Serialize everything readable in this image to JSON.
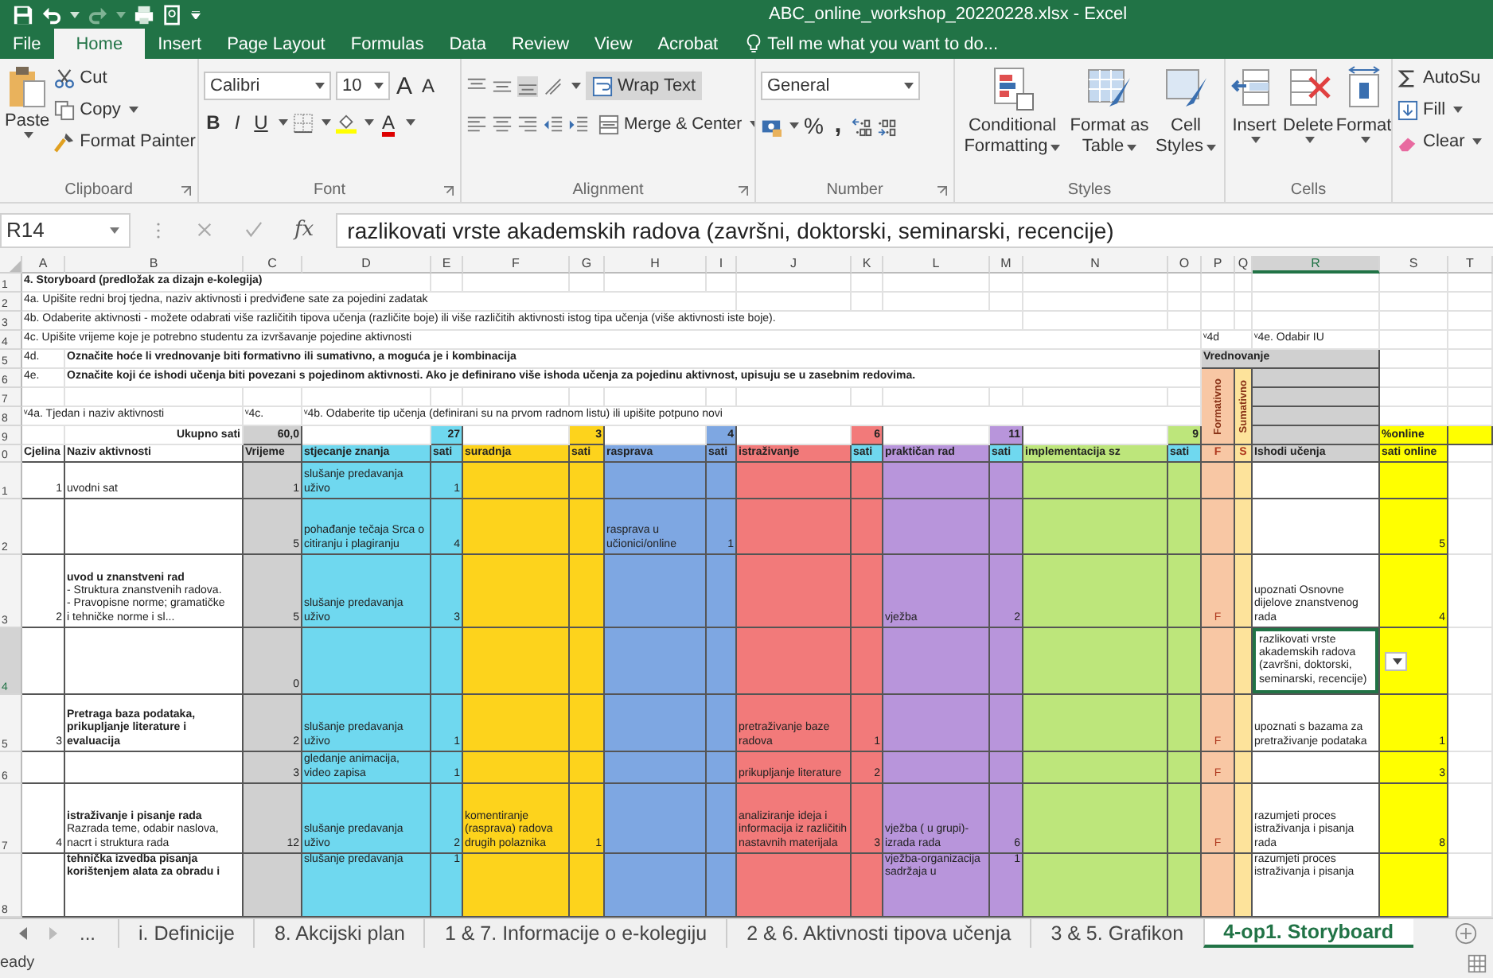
{
  "title_bar": {
    "title": "ABC_online_workshop_20220228.xlsx - Excel"
  },
  "ribbon_tabs": [
    {
      "label": "File",
      "selected": false
    },
    {
      "label": "Home",
      "selected": true
    },
    {
      "label": "Insert",
      "selected": false
    },
    {
      "label": "Page Layout",
      "selected": false
    },
    {
      "label": "Formulas",
      "selected": false
    },
    {
      "label": "Data",
      "selected": false
    },
    {
      "label": "Review",
      "selected": false
    },
    {
      "label": "View",
      "selected": false
    },
    {
      "label": "Acrobat",
      "selected": false
    }
  ],
  "tell_me": {
    "placeholder": "Tell me what you want to do..."
  },
  "clipboard": {
    "paste": "Paste",
    "cut": "Cut",
    "copy": "Copy",
    "format_painter": "Format Painter",
    "label": "Clipboard"
  },
  "font": {
    "family": "Calibri",
    "size": "10",
    "grow": "A",
    "shrink": "A",
    "bold": "B",
    "italic": "I",
    "underline": "U",
    "font_color": "A",
    "label": "Font"
  },
  "alignment": {
    "wrap_text": "Wrap Text",
    "merge": "Merge & Center",
    "label": "Alignment"
  },
  "number": {
    "format": "General",
    "percent": "%",
    "comma": ",",
    "label": "Number"
  },
  "styles": {
    "label": "Styles",
    "buttons": [
      {
        "label": "Conditional Formatting",
        "kind": "conditional"
      },
      {
        "label": "Format as Table",
        "kind": "table"
      },
      {
        "label": "Cell Styles",
        "kind": "cellstyle"
      }
    ]
  },
  "cells": {
    "label": "Cells",
    "buttons": [
      {
        "label": "Insert",
        "kind": "insert"
      },
      {
        "label": "Delete",
        "kind": "delete"
      },
      {
        "label": "Format",
        "kind": "format"
      }
    ]
  },
  "editing": {
    "autosum": "AutoSu",
    "fill": "Fill",
    "clear": "Clear"
  },
  "formula_bar": {
    "name_box": "R14",
    "fx": "fx",
    "formula": "razlikovati vrste akademskih radova (završni, doktorski, seminarski, recencije)"
  },
  "sheet": {
    "columns": [
      {
        "label": "A",
        "selected": false
      },
      {
        "label": "B",
        "selected": false
      },
      {
        "label": "C",
        "selected": false
      },
      {
        "label": "D",
        "selected": false
      },
      {
        "label": "E",
        "selected": false
      },
      {
        "label": "F",
        "selected": false
      },
      {
        "label": "G",
        "selected": false
      },
      {
        "label": "H",
        "selected": false
      },
      {
        "label": "I",
        "selected": false
      },
      {
        "label": "J",
        "selected": false
      },
      {
        "label": "K",
        "selected": false
      },
      {
        "label": "L",
        "selected": false
      },
      {
        "label": "M",
        "selected": false
      },
      {
        "label": "N",
        "selected": false
      },
      {
        "label": "O",
        "selected": false
      },
      {
        "label": "P",
        "selected": false
      },
      {
        "label": "Q",
        "selected": false
      },
      {
        "label": "R",
        "selected": true
      },
      {
        "label": "S",
        "selected": false
      },
      {
        "label": "T",
        "selected": false
      }
    ],
    "rows": [
      {
        "number": "1",
        "kind": "note",
        "selected": false,
        "cells": [
          {
            "text": "4. Storyboard (predložak za dizajn e-kolegija)",
            "kind": "bold"
          },
          {},
          {},
          {}
        ]
      },
      {
        "number": "2",
        "kind": "note",
        "selected": false,
        "cells": [
          {
            "text": "4a. Upišite redni broj tjedna, naziv aktivnosti i predviđene sate za pojedini zadatak",
            "kind": "text"
          },
          {},
          {},
          {},
          {},
          {},
          {},
          {},
          {}
        ]
      },
      {
        "number": "3",
        "kind": "note",
        "selected": false,
        "cells": [
          {
            "text": "4b. Odaberite aktivnosti - možete odabrati više različitih tipova učenja (različite boje) ili više različitih aktivnosti istog tipa učenja (više aktivnosti iste boje).",
            "kind": "text"
          },
          {},
          {},
          {},
          {},
          {},
          {},
          {},
          {},
          {},
          {},
          {},
          {}
        ]
      },
      {
        "number": "4",
        "kind": "note",
        "selected": false,
        "cells": [
          {
            "text": "4c. Upišite  vrijeme koje je potrebno studentu za izvršavanje pojedine aktivnosti",
            "kind": "text"
          },
          {},
          {},
          {},
          {},
          {},
          {},
          {},
          {},
          {},
          {},
          {},
          {},
          {},
          {},
          {
            "text": "ᵛ4d",
            "kind": "text"
          },
          {},
          {
            "text": "ᵛ4e. Odabir IU",
            "kind": "text"
          }
        ]
      },
      {
        "number": "5",
        "kind": "note",
        "selected": false,
        "cells": [
          {
            "text": "4d.",
            "kind": "text"
          },
          {
            "text": "Označite hoće li vrednovanje biti formativno ili sumativno, a moguća je i kombinacija",
            "kind": "bold"
          },
          {},
          {},
          {},
          {},
          {},
          {},
          {},
          {},
          {},
          {},
          {},
          {},
          {},
          {
            "text": "Vrednovanje",
            "kind": "bold",
            "color": "#d0d0d0"
          },
          {},
          {}
        ]
      },
      {
        "number": "6",
        "kind": "note",
        "selected": false,
        "cells": [
          {
            "text": "4e.",
            "kind": "text"
          },
          {
            "text": "Označite koji će ishodi učenja biti povezani s pojedinom aktivnosti. Ako je definirano više ishoda učenja za pojedinu aktivnost, upisuju se u zasebnim redovima.",
            "kind": "bold"
          },
          {},
          {},
          {},
          {},
          {},
          {},
          {},
          {},
          {},
          {},
          {},
          {},
          {},
          {
            "text": "Formativno",
            "kind": "vertical",
            "color": "#f8c7a4"
          },
          {
            "text": "Sumativno",
            "kind": "vertical",
            "color": "#fde39b"
          },
          {
            "color": "#d0d0d0"
          }
        ]
      },
      {
        "number": "7",
        "kind": "note",
        "selected": false,
        "cells": [
          {},
          {},
          {},
          {},
          {},
          {},
          {},
          {},
          {},
          {},
          {},
          {},
          {},
          {},
          {},
          {},
          {},
          {
            "color": "#d0d0d0"
          }
        ]
      },
      {
        "number": "8",
        "kind": "note",
        "selected": false,
        "cells": [
          {
            "text": "ᵛ4a. Tjedan i naziv aktivnosti",
            "kind": "text"
          },
          {},
          {
            "text": "ᵛ4c.",
            "kind": "text"
          },
          {
            "text": "ᵛ4b. Odaberite tip učenja (definirani su na prvom radnom listu) ili upišite potpuno novi",
            "kind": "text"
          },
          {},
          {},
          {},
          {},
          {},
          {},
          {},
          {},
          {},
          {},
          {},
          {},
          {},
          {
            "color": "#d0d0d0"
          }
        ]
      },
      {
        "number": "9",
        "kind": "total",
        "selected": false,
        "cells": [
          {},
          {
            "text": "Ukupno sati",
            "kind": "number"
          },
          {
            "text": "60,0",
            "kind": "number",
            "color": "#d0d0d0"
          },
          {},
          {
            "text": "27",
            "kind": "number",
            "color": "#6fd8ef"
          },
          {},
          {
            "text": "3",
            "kind": "number",
            "color": "#fdd31c"
          },
          {},
          {
            "text": "4",
            "kind": "number",
            "color": "#7ea7e2"
          },
          {},
          {
            "text": "6",
            "kind": "number",
            "color": "#f27a7a"
          },
          {},
          {
            "text": "11",
            "kind": "number",
            "color": "#b895db"
          },
          {},
          {
            "text": "9",
            "kind": "number",
            "color": "#bde67b"
          },
          {},
          {},
          {
            "color": "#d0d0d0"
          },
          {
            "text": "%online",
            "kind": "text",
            "color": "#ffff00"
          },
          {
            "color": "#ffff00"
          }
        ]
      },
      {
        "number": "0",
        "kind": "header",
        "selected": false,
        "cells": [
          {
            "text": "Cjelina",
            "kind": "text"
          },
          {
            "text": "Naziv aktivnosti",
            "kind": "text"
          },
          {
            "text": "Vrijeme",
            "kind": "text",
            "color": "#d0d0d0"
          },
          {
            "text": "stjecanje znanja",
            "kind": "text",
            "color": "#6fd8ef"
          },
          {
            "text": "sati",
            "kind": "text",
            "color": "#6fd8ef"
          },
          {
            "text": "suradnja",
            "kind": "text",
            "color": "#fdd31c"
          },
          {
            "text": "sati",
            "kind": "text",
            "color": "#fdd31c"
          },
          {
            "text": "rasprava",
            "kind": "text",
            "color": "#7ea7e2"
          },
          {
            "text": "sati",
            "kind": "text",
            "color": "#7ea7e2"
          },
          {
            "text": "istraživanje",
            "kind": "text",
            "color": "#f27a7a"
          },
          {
            "text": "sati",
            "kind": "text",
            "color": "#6fd8ef"
          },
          {
            "text": "praktičan rad",
            "kind": "text",
            "color": "#b895db"
          },
          {
            "text": "sati",
            "kind": "text",
            "color": "#6fd8ef"
          },
          {
            "text": "implementacija sz",
            "kind": "text",
            "color": "#bde67b"
          },
          {
            "text": "sati",
            "kind": "text",
            "color": "#6fd8ef"
          },
          {
            "text": "F",
            "kind": "center",
            "color": "#f8c7a4"
          },
          {
            "text": "S",
            "kind": "center",
            "color": "#fde39b"
          },
          {
            "text": "Ishodi učenja",
            "kind": "text",
            "color": "#d0d0d0"
          },
          {
            "text": "sati online",
            "kind": "text",
            "color": "#ffff00"
          },
          {}
        ]
      },
      {
        "number": "1",
        "kind": "data",
        "selected": false,
        "cells": [
          {
            "text": "1",
            "kind": "number"
          },
          {
            "text": "uvodni sat",
            "kind": "text"
          },
          {
            "text": "1",
            "kind": "number",
            "color": "#d0d0d0"
          },
          {
            "text": "slušanje predavanja uživo",
            "kind": "text",
            "color": "#6fd8ef"
          },
          {
            "text": "1",
            "kind": "number",
            "color": "#6fd8ef"
          },
          {
            "color": "#fdd31c"
          },
          {
            "color": "#fdd31c"
          },
          {
            "color": "#7ea7e2"
          },
          {
            "color": "#7ea7e2"
          },
          {
            "color": "#f27a7a"
          },
          {
            "color": "#f27a7a"
          },
          {
            "color": "#b895db"
          },
          {
            "color": "#b895db"
          },
          {
            "color": "#bde67b"
          },
          {
            "color": "#bde67b"
          },
          {
            "color": "#f8c7a4"
          },
          {
            "color": "#fde39b"
          },
          {},
          {
            "color": "#ffff00"
          },
          {}
        ]
      },
      {
        "number": "2",
        "kind": "data",
        "selected": false,
        "cells": [
          {},
          {},
          {
            "text": "5",
            "kind": "number",
            "color": "#d0d0d0"
          },
          {
            "text": "pohađanje tečaja Srca o citiranju i plagiranju",
            "kind": "text",
            "color": "#6fd8ef"
          },
          {
            "text": "4",
            "kind": "number",
            "color": "#6fd8ef"
          },
          {
            "color": "#fdd31c"
          },
          {
            "color": "#fdd31c"
          },
          {
            "text": "rasprava u učionici/online",
            "kind": "text",
            "color": "#7ea7e2"
          },
          {
            "text": "1",
            "kind": "number",
            "color": "#7ea7e2"
          },
          {
            "color": "#f27a7a"
          },
          {
            "color": "#f27a7a"
          },
          {
            "color": "#b895db"
          },
          {
            "color": "#b895db"
          },
          {
            "color": "#bde67b"
          },
          {
            "color": "#bde67b"
          },
          {
            "color": "#f8c7a4"
          },
          {
            "color": "#fde39b"
          },
          {},
          {
            "text": "5",
            "kind": "number",
            "color": "#ffff00"
          },
          {}
        ]
      },
      {
        "number": "3",
        "kind": "data",
        "selected": false,
        "cells": [
          {
            "text": "2",
            "kind": "number"
          },
          {
            "text": "**uvod u znanstveni rad**\n- Struktura znanstvenih radova.\n- Pravopisne norme; gramatičke\ni tehničke norme i sl...",
            "kind": "text"
          },
          {
            "text": "5",
            "kind": "number",
            "color": "#d0d0d0"
          },
          {
            "text": "slušanje predavanja uživo",
            "kind": "text",
            "color": "#6fd8ef"
          },
          {
            "text": "3",
            "kind": "number",
            "color": "#6fd8ef"
          },
          {
            "color": "#fdd31c"
          },
          {
            "color": "#fdd31c"
          },
          {
            "color": "#7ea7e2"
          },
          {
            "color": "#7ea7e2"
          },
          {
            "color": "#f27a7a"
          },
          {
            "color": "#f27a7a"
          },
          {
            "text": "vježba",
            "kind": "text",
            "color": "#b895db"
          },
          {
            "text": "2",
            "kind": "number",
            "color": "#b895db"
          },
          {
            "color": "#bde67b"
          },
          {
            "color": "#bde67b"
          },
          {
            "text": "F",
            "kind": "center",
            "color": "#f8c7a4"
          },
          {
            "color": "#fde39b"
          },
          {
            "text": "upoznati Osnovne dijelove znanstvenog rada",
            "kind": "text"
          },
          {
            "text": "4",
            "kind": "number",
            "color": "#ffff00"
          },
          {}
        ]
      },
      {
        "number": "4",
        "kind": "data",
        "selected": true,
        "cells": [
          {},
          {},
          {
            "text": "0",
            "kind": "number",
            "color": "#d0d0d0"
          },
          {
            "color": "#6fd8ef"
          },
          {
            "color": "#6fd8ef"
          },
          {
            "color": "#fdd31c"
          },
          {
            "color": "#fdd31c"
          },
          {
            "color": "#7ea7e2"
          },
          {
            "color": "#7ea7e2"
          },
          {
            "color": "#f27a7a"
          },
          {
            "color": "#f27a7a"
          },
          {
            "color": "#b895db"
          },
          {
            "color": "#b895db"
          },
          {
            "color": "#bde67b"
          },
          {
            "color": "#bde67b"
          },
          {
            "color": "#f8c7a4"
          },
          {
            "color": "#fde39b"
          },
          {
            "text": "razlikovati vrste akademskih radova (završni, doktorski, seminarski, recencije)",
            "kind": "text"
          },
          {
            "color": "#ffff00"
          },
          {}
        ]
      },
      {
        "number": "5",
        "kind": "data",
        "selected": false,
        "cells": [
          {
            "text": "3",
            "kind": "number"
          },
          {
            "text": "Pretraga baza podataka, prikupljanje literature i evaluacija",
            "kind": "bold"
          },
          {
            "text": "2",
            "kind": "number",
            "color": "#d0d0d0"
          },
          {
            "text": "slušanje predavanja uživo",
            "kind": "text",
            "color": "#6fd8ef"
          },
          {
            "text": "1",
            "kind": "number",
            "color": "#6fd8ef"
          },
          {
            "color": "#fdd31c"
          },
          {
            "color": "#fdd31c"
          },
          {
            "color": "#7ea7e2"
          },
          {
            "color": "#7ea7e2"
          },
          {
            "text": "pretraživanje baze radova",
            "kind": "text",
            "color": "#f27a7a"
          },
          {
            "text": "1",
            "kind": "number",
            "color": "#f27a7a"
          },
          {
            "color": "#b895db"
          },
          {
            "color": "#b895db"
          },
          {
            "color": "#bde67b"
          },
          {
            "color": "#bde67b"
          },
          {
            "text": "F",
            "kind": "center",
            "color": "#f8c7a4"
          },
          {
            "color": "#fde39b"
          },
          {
            "text": "upoznati s bazama za pretraživanje podataka",
            "kind": "text"
          },
          {
            "text": "1",
            "kind": "number",
            "color": "#ffff00"
          },
          {}
        ]
      },
      {
        "number": "6",
        "kind": "data",
        "selected": false,
        "cells": [
          {},
          {},
          {
            "text": "3",
            "kind": "number",
            "color": "#d0d0d0"
          },
          {
            "text": "gledanje animacija, video zapisa",
            "kind": "text",
            "color": "#6fd8ef"
          },
          {
            "text": "1",
            "kind": "number",
            "color": "#6fd8ef"
          },
          {
            "color": "#fdd31c"
          },
          {
            "color": "#fdd31c"
          },
          {
            "color": "#7ea7e2"
          },
          {
            "color": "#7ea7e2"
          },
          {
            "text": "prikupljanje literature",
            "kind": "text",
            "color": "#f27a7a"
          },
          {
            "text": "2",
            "kind": "number",
            "color": "#f27a7a"
          },
          {
            "color": "#b895db"
          },
          {
            "color": "#b895db"
          },
          {
            "color": "#bde67b"
          },
          {
            "color": "#bde67b"
          },
          {
            "text": "F",
            "kind": "center",
            "color": "#f8c7a4"
          },
          {
            "color": "#fde39b"
          },
          {},
          {
            "text": "3",
            "kind": "number",
            "color": "#ffff00"
          },
          {}
        ]
      },
      {
        "number": "7",
        "kind": "data",
        "selected": false,
        "cells": [
          {
            "text": "4",
            "kind": "number"
          },
          {
            "text": "**istraživanje i pisanje rada**\nRazrada teme, odabir naslova,\nnacrt i struktura rada",
            "kind": "text"
          },
          {
            "text": "12",
            "kind": "number",
            "color": "#d0d0d0"
          },
          {
            "text": "slušanje predavanja uživo",
            "kind": "text",
            "color": "#6fd8ef"
          },
          {
            "text": "2",
            "kind": "number",
            "color": "#6fd8ef"
          },
          {
            "text": "komentiranje (rasprava) radova drugih polaznika",
            "kind": "text",
            "color": "#fdd31c"
          },
          {
            "text": "1",
            "kind": "number",
            "color": "#fdd31c"
          },
          {
            "color": "#7ea7e2"
          },
          {
            "color": "#7ea7e2"
          },
          {
            "text": "analiziranje ideja i informacija iz različitih nastavnih materijala",
            "kind": "text",
            "color": "#f27a7a"
          },
          {
            "text": "3",
            "kind": "number",
            "color": "#f27a7a"
          },
          {
            "text": "vježba ( u grupi)-izrada rada",
            "kind": "text",
            "color": "#b895db"
          },
          {
            "text": "6",
            "kind": "number",
            "color": "#b895db"
          },
          {
            "color": "#bde67b"
          },
          {
            "color": "#bde67b"
          },
          {
            "text": "F",
            "kind": "center",
            "color": "#f8c7a4"
          },
          {
            "color": "#fde39b"
          },
          {
            "text": "razumjeti proces istraživanja i pisanja rada",
            "kind": "text"
          },
          {
            "text": "8",
            "kind": "number",
            "color": "#ffff00"
          },
          {}
        ]
      },
      {
        "number": "8",
        "kind": "cut",
        "selected": false,
        "cells": [
          {},
          {
            "text": "tehnička izvedba pisanja korištenjem alata za obradu i",
            "kind": "bold"
          },
          {
            "color": "#d0d0d0"
          },
          {
            "text": "slušanje predavanja",
            "kind": "text",
            "color": "#6fd8ef"
          },
          {
            "text": "1",
            "kind": "number",
            "color": "#6fd8ef"
          },
          {
            "color": "#fdd31c"
          },
          {
            "color": "#fdd31c"
          },
          {
            "color": "#7ea7e2"
          },
          {
            "color": "#7ea7e2"
          },
          {
            "color": "#f27a7a"
          },
          {
            "color": "#f27a7a"
          },
          {
            "text": "vježba-organizacija sadržaja u",
            "kind": "text",
            "color": "#b895db"
          },
          {
            "text": "1",
            "kind": "number",
            "color": "#b895db"
          },
          {
            "color": "#bde67b"
          },
          {
            "color": "#bde67b"
          },
          {
            "color": "#f8c7a4"
          },
          {
            "color": "#fde39b"
          },
          {
            "text": "razumjeti proces istraživanja i pisanja",
            "kind": "text"
          },
          {
            "color": "#ffff00"
          },
          {}
        ]
      }
    ]
  },
  "sheet_tabs": {
    "more": "...",
    "tabs": [
      {
        "label": "i. Definicije",
        "selected": false
      },
      {
        "label": "8. Akcijski plan",
        "selected": false
      },
      {
        "label": "1 & 7. Informacije o e-kolegiju",
        "selected": false
      },
      {
        "label": "2 & 6. Aktivnosti tipova učenja",
        "selected": false
      },
      {
        "label": "3 & 5. Grafikon",
        "selected": false
      },
      {
        "label": "4-op1. Storyboard",
        "selected": true
      }
    ]
  },
  "status_bar": {
    "text": "eady"
  }
}
